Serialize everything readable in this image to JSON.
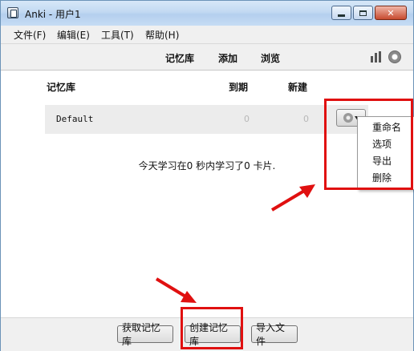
{
  "window": {
    "title": "Anki - 用户1",
    "min_label": "",
    "max_label": "",
    "close_label": "✕"
  },
  "menu": {
    "file": "文件(F)",
    "edit": "编辑(E)",
    "tools": "工具(T)",
    "help": "帮助(H)"
  },
  "toolbar": {
    "decks": "记忆库",
    "add": "添加",
    "browse": "浏览"
  },
  "deck_list": {
    "headers": {
      "deck": "记忆库",
      "due": "到期",
      "new": "新建"
    },
    "rows": [
      {
        "name": "Default",
        "due": "0",
        "new": "0"
      }
    ]
  },
  "context_menu": {
    "rename": "重命名",
    "options": "选项",
    "export": "导出",
    "delete": "删除"
  },
  "summary": "今天学习在0 秒内学习了0 卡片.",
  "buttons": {
    "get_shared": "获取记忆库",
    "create_deck": "创建记忆库",
    "import_file": "导入文件"
  },
  "colors": {
    "annotation_red": "#e01010"
  }
}
